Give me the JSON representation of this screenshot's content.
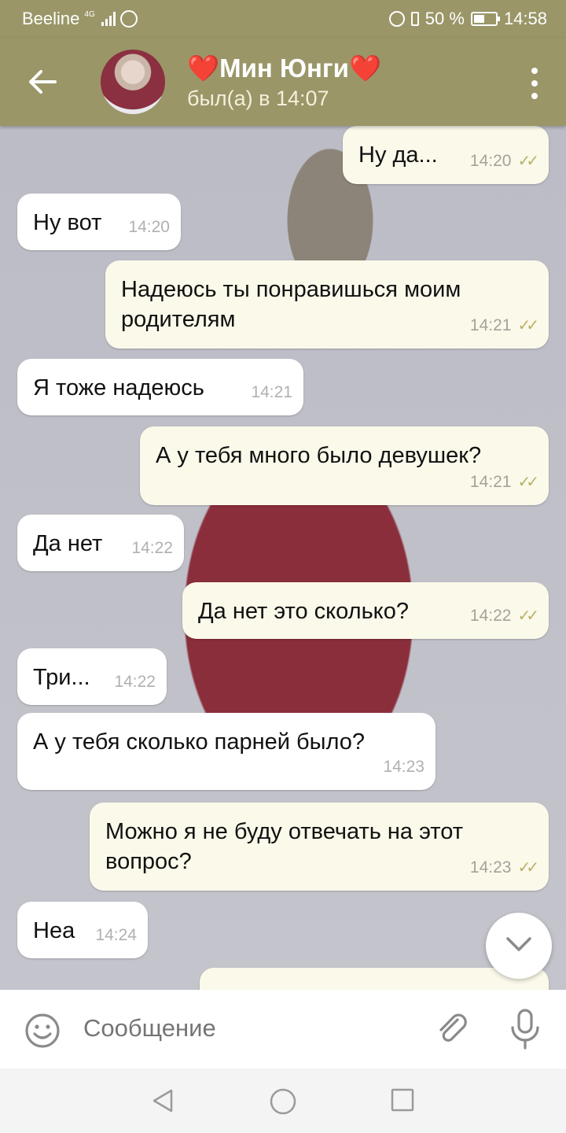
{
  "status_bar": {
    "carrier": "Beeline",
    "network": "4G",
    "battery": "50 %",
    "battery_level": 0.5,
    "time": "14:58"
  },
  "header": {
    "title": "❤️Мин Юнги❤️",
    "subtitle": "был(а) в 14:07"
  },
  "messages": [
    {
      "dir": "out",
      "text": "Ну да...",
      "time": "14:20",
      "read": true
    },
    {
      "dir": "in",
      "text": "Ну вот",
      "time": "14:20"
    },
    {
      "dir": "out",
      "text_lines": [
        "Надеюсь ты понравишься моим",
        "родителям"
      ],
      "time": "14:21",
      "read": true
    },
    {
      "dir": "in",
      "text": "Я тоже надеюсь",
      "time": "14:21"
    },
    {
      "dir": "out",
      "text": "А у тебя много было девушек?",
      "time": "14:21",
      "read": true
    },
    {
      "dir": "in",
      "text": "Да нет",
      "time": "14:22"
    },
    {
      "dir": "out",
      "text": "Да нет это сколько?",
      "time": "14:22",
      "read": true
    },
    {
      "dir": "in",
      "text": "Три...",
      "time": "14:22"
    },
    {
      "dir": "in",
      "text": "А у тебя сколько парней было?",
      "time": "14:23"
    },
    {
      "dir": "out",
      "text_lines": [
        "Можно я не буду отвечать на этот",
        "вопрос?"
      ],
      "time": "14:23",
      "read": true
    },
    {
      "dir": "in",
      "text": "Неа",
      "time": "14:24"
    }
  ],
  "input": {
    "placeholder": "Сообщение"
  },
  "icons": {
    "back": "arrow-left-icon",
    "menu": "more-vertical-icon",
    "emoji": "smiley-icon",
    "attach": "paperclip-icon",
    "mic": "microphone-icon",
    "scroll": "chevron-down-icon"
  },
  "colors": {
    "header": "#9a9668",
    "outgoing_bubble": "#fbf9ea",
    "incoming_bubble": "#ffffff",
    "read_ticks": "#b8b266"
  }
}
